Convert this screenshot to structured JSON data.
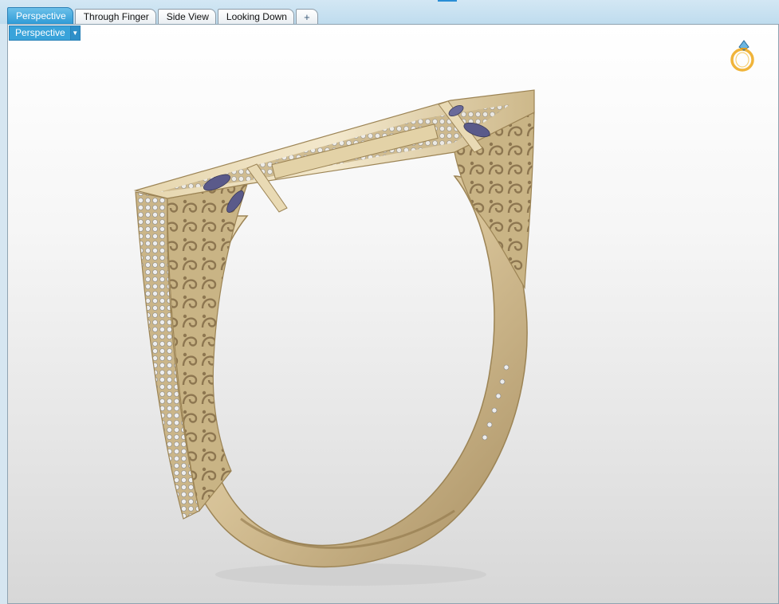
{
  "app": {
    "accent_color": "#39a3da",
    "metal_color": "#d8c49a",
    "stone_color": "#5a5a8a"
  },
  "tabs": [
    {
      "label": "Perspective",
      "active": true
    },
    {
      "label": "Through Finger",
      "active": false
    },
    {
      "label": "Side View",
      "active": false
    },
    {
      "label": "Looking Down",
      "active": false
    }
  ],
  "add_tab_label": "+",
  "viewport": {
    "label": "Perspective",
    "dropdown_icon": "caret-down-icon",
    "logo_icon": "ring-logo-icon",
    "model": "bracelet-3d-model"
  }
}
